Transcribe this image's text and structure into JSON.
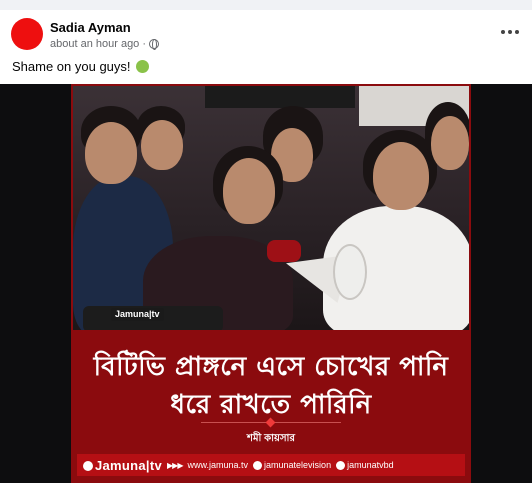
{
  "post": {
    "author": "Sadia Ayman",
    "timestamp": "about an hour ago",
    "audience_icon": "globe-icon",
    "caption": "Shame on you guys!",
    "caption_emoji": "nauseated-face-emoji"
  },
  "card": {
    "headline_line1": "বিটিভি প্রাঙ্গনে এসে চোখের পানি",
    "headline_line2": "ধরে রাখতে পারিনি",
    "reporter": "শমী কায়সার",
    "mic_logo": "Jamuna|tv",
    "footer": {
      "brand": "Jamuna|tv",
      "website": "www.jamuna.tv",
      "facebook": "jamunatelevision",
      "youtube": "jamunatvbd"
    }
  },
  "colors": {
    "avatar": "#ee0f0f",
    "card_background": "#8b0b0e",
    "footer_bar": "#b50f14"
  }
}
